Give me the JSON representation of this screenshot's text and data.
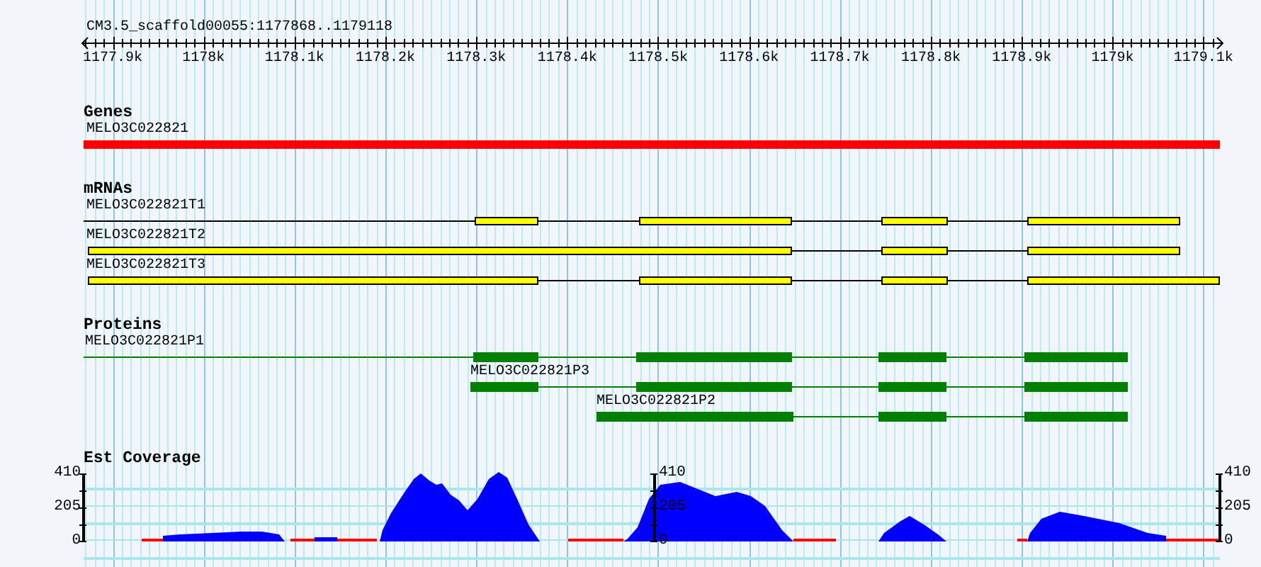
{
  "title": "CM3.5_scaffold00055:1177868..1179118",
  "ruler": {
    "labels": [
      "1177.9k",
      "1178k",
      "1178.1k",
      "1178.2k",
      "1178.3k",
      "1178.4k",
      "1178.5k",
      "1178.6k",
      "1178.7k",
      "1178.8k",
      "1178.9k",
      "1179k",
      "1179.1k"
    ]
  },
  "tracks": [
    {
      "kind": "genes",
      "title": "Genes",
      "features": [
        {
          "label": "MELO3C022821"
        }
      ]
    },
    {
      "kind": "mrnas",
      "title": "mRNAs",
      "features": [
        {
          "label": "MELO3C022821T1"
        },
        {
          "label": "MELO3C022821T2"
        },
        {
          "label": "MELO3C022821T3"
        }
      ]
    },
    {
      "kind": "proteins",
      "title": "Proteins",
      "features": [
        {
          "label": "MELO3C022821P1"
        },
        {
          "label": "MELO3C022821P3"
        },
        {
          "label": "MELO3C022821P2"
        }
      ]
    },
    {
      "kind": "coverage",
      "title": "Est Coverage",
      "axes": [
        {
          "ticks": [
            "410",
            "205",
            "0"
          ]
        },
        {
          "ticks": [
            "410",
            "205",
            "0"
          ]
        },
        {
          "ticks": [
            "410",
            "205",
            "0"
          ]
        }
      ]
    }
  ]
}
